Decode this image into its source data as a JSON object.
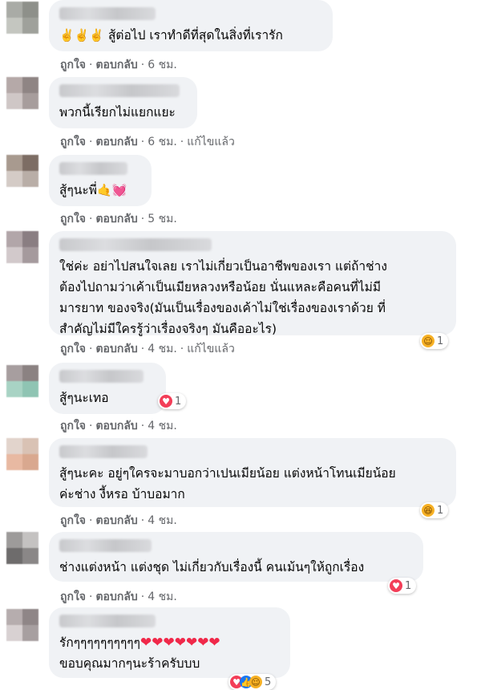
{
  "action_labels": {
    "like": "ถูกใจ",
    "reply": "ตอบกลับ",
    "dot": "·",
    "edited": "แก้ไขแล้ว"
  },
  "icons": {
    "reaction_love": "heart-icon",
    "reaction_haha": "haha-icon",
    "reaction_care": "care-icon",
    "reaction_like": "like-icon"
  },
  "colors": {
    "bubble": "#f0f2f5",
    "secondary_text": "#65676b",
    "love": "#f33e58",
    "like": "#1877f2",
    "haha": "#f7b125"
  },
  "comments": [
    {
      "emoji": "✌️✌️✌️",
      "text": "สู้ต่อไป เราทำดีที่สุดในสิ่งที่เรารัก",
      "time": "6 ชม.",
      "edited": false
    },
    {
      "text": "พวกนี้เรียกไม่แยกแยะ",
      "time": "6 ชม.",
      "edited": true
    },
    {
      "text": "สู้ๆนะพี่",
      "emoji": "🤙💓",
      "time": "5 ชม.",
      "edited": false
    },
    {
      "text": "ใช่ค่ะ อย่าไปสนใจเลย เราไม่เกี่ยวเป็นอาชีพของเรา แต่ถ้าช่าง\nต้องไปถามว่าเค้าเป็นเมียหลวงหรือน้อย นั่นแหละคือคนที่ไม่มี\nมารยาท ของจริง(มันเป็นเรื่องของเค้าไม่ใช่เรื่องของเราด้วย ที่\nสำคัญไม่มีใครรู้ว่าเรื่องจริงๆ มันคืออะไร)",
      "time": "4 ชม.",
      "edited": true,
      "reaction_count": "1"
    },
    {
      "text": "สู้ๆนะเทอ",
      "time": "4 ชม.",
      "edited": false,
      "reaction_count": "1"
    },
    {
      "text": "สู้ๆนะคะ อยู่ๆใครจะมาบอกว่าเปนเมียน้อย แต่งหน้าโทนเมียน้อย\nค่ะช่าง งี้หรอ บ้าบอมาก",
      "time": "4 ชม.",
      "edited": false,
      "reaction_count": "1"
    },
    {
      "text": "ช่างแต่งหน้า แต่งชุด ไม่เกี่ยวกับเรื่องนี้ คนเม้นๆให้ถูกเรื่อง",
      "time": "4 ชม.",
      "edited": false,
      "reaction_count": "1"
    },
    {
      "text": "รักๆๆๆๆๆๆๆๆๆๆ",
      "hearts": "❤❤❤❤❤❤❤",
      "text2": "ขอบคุณมากๆนะร้าครับบบ",
      "reaction_count": "5"
    }
  ]
}
